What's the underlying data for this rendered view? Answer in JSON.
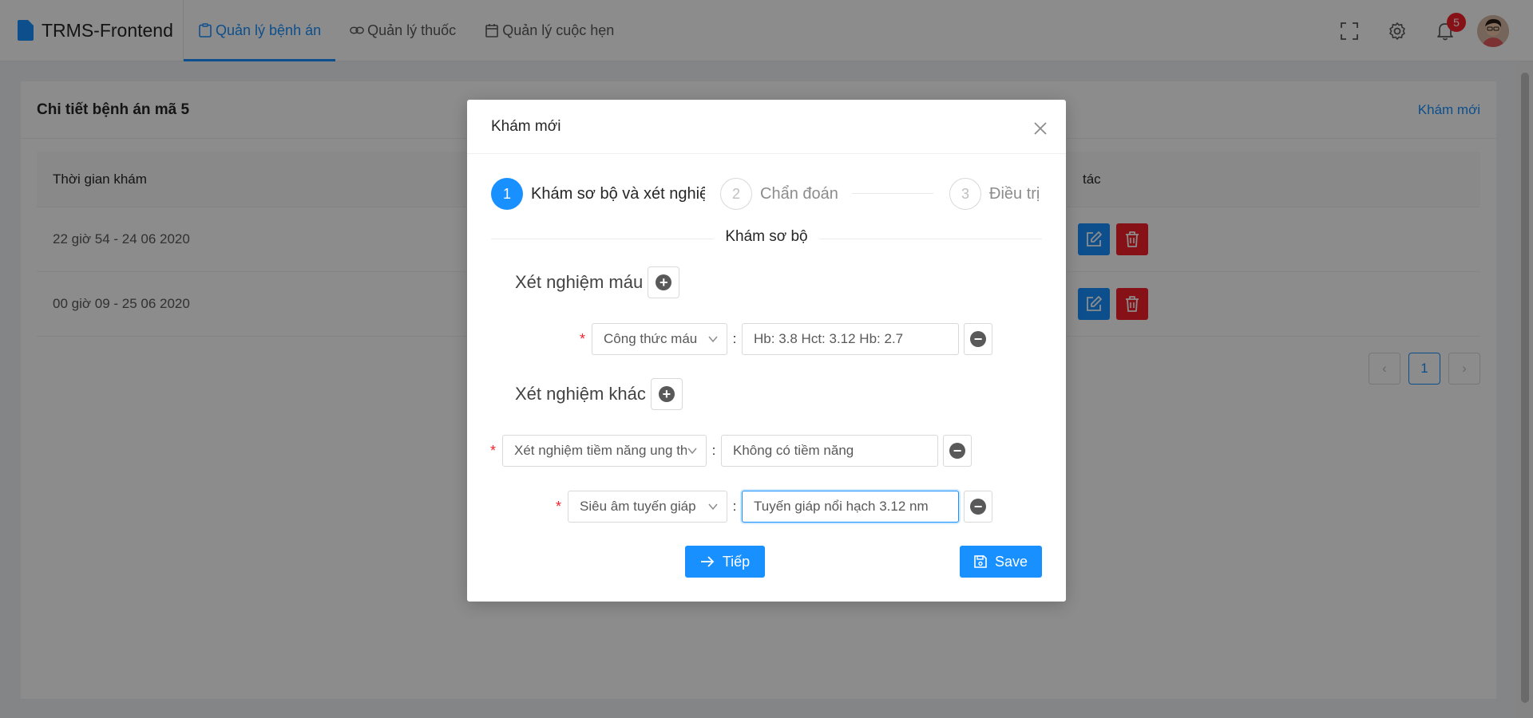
{
  "app": {
    "brand": "TRMS-Frontend",
    "nav": [
      {
        "label": "Quản lý bệnh án",
        "icon": "clipboard-icon",
        "active": true
      },
      {
        "label": "Quản lý thuốc",
        "icon": "link-icon",
        "active": false
      },
      {
        "label": "Quản lý cuộc hẹn",
        "icon": "calendar-icon",
        "active": false
      }
    ],
    "header_actions": {
      "notifications_count": "5"
    }
  },
  "page": {
    "title": "Chi tiết bệnh án mã 5",
    "new_exam_link": "Khám mới",
    "table": {
      "columns": [
        "Thời gian khám",
        "tác"
      ],
      "rows": [
        {
          "time": "22 giờ 54 - 24 06 2020"
        },
        {
          "time": "00 giờ 09 - 25 06 2020"
        }
      ]
    },
    "pagination": {
      "current": "1",
      "prev": "‹",
      "next": "›"
    }
  },
  "modal": {
    "title": "Khám mới",
    "steps": [
      {
        "number": "1",
        "label": "Khám sơ bộ và xét nghiệm",
        "status": "process"
      },
      {
        "number": "2",
        "label": "Chẩn đoán",
        "status": "wait"
      },
      {
        "number": "3",
        "label": "Điều trị",
        "status": "wait"
      }
    ],
    "divider": "Khám sơ bộ",
    "blood_tests": {
      "title": "Xét nghiệm máu",
      "items": [
        {
          "type": "Công thức máu",
          "value": "Hb: 3.8 Hct: 3.12 Hb: 2.7"
        }
      ]
    },
    "other_tests": {
      "title": "Xét nghiệm khác",
      "items": [
        {
          "type": "Xét nghiệm tiềm năng ung thư",
          "value": "Không có tiềm năng"
        },
        {
          "type": "Siêu âm tuyến giáp",
          "value": "Tuyến giáp nổi hạch 3.12 nm"
        }
      ]
    },
    "next_button": "Tiếp",
    "save_button": "Save"
  },
  "colors": {
    "primary": "#1890ff",
    "danger": "#f5222d",
    "mask": "rgba(0,0,0,0.45)"
  }
}
